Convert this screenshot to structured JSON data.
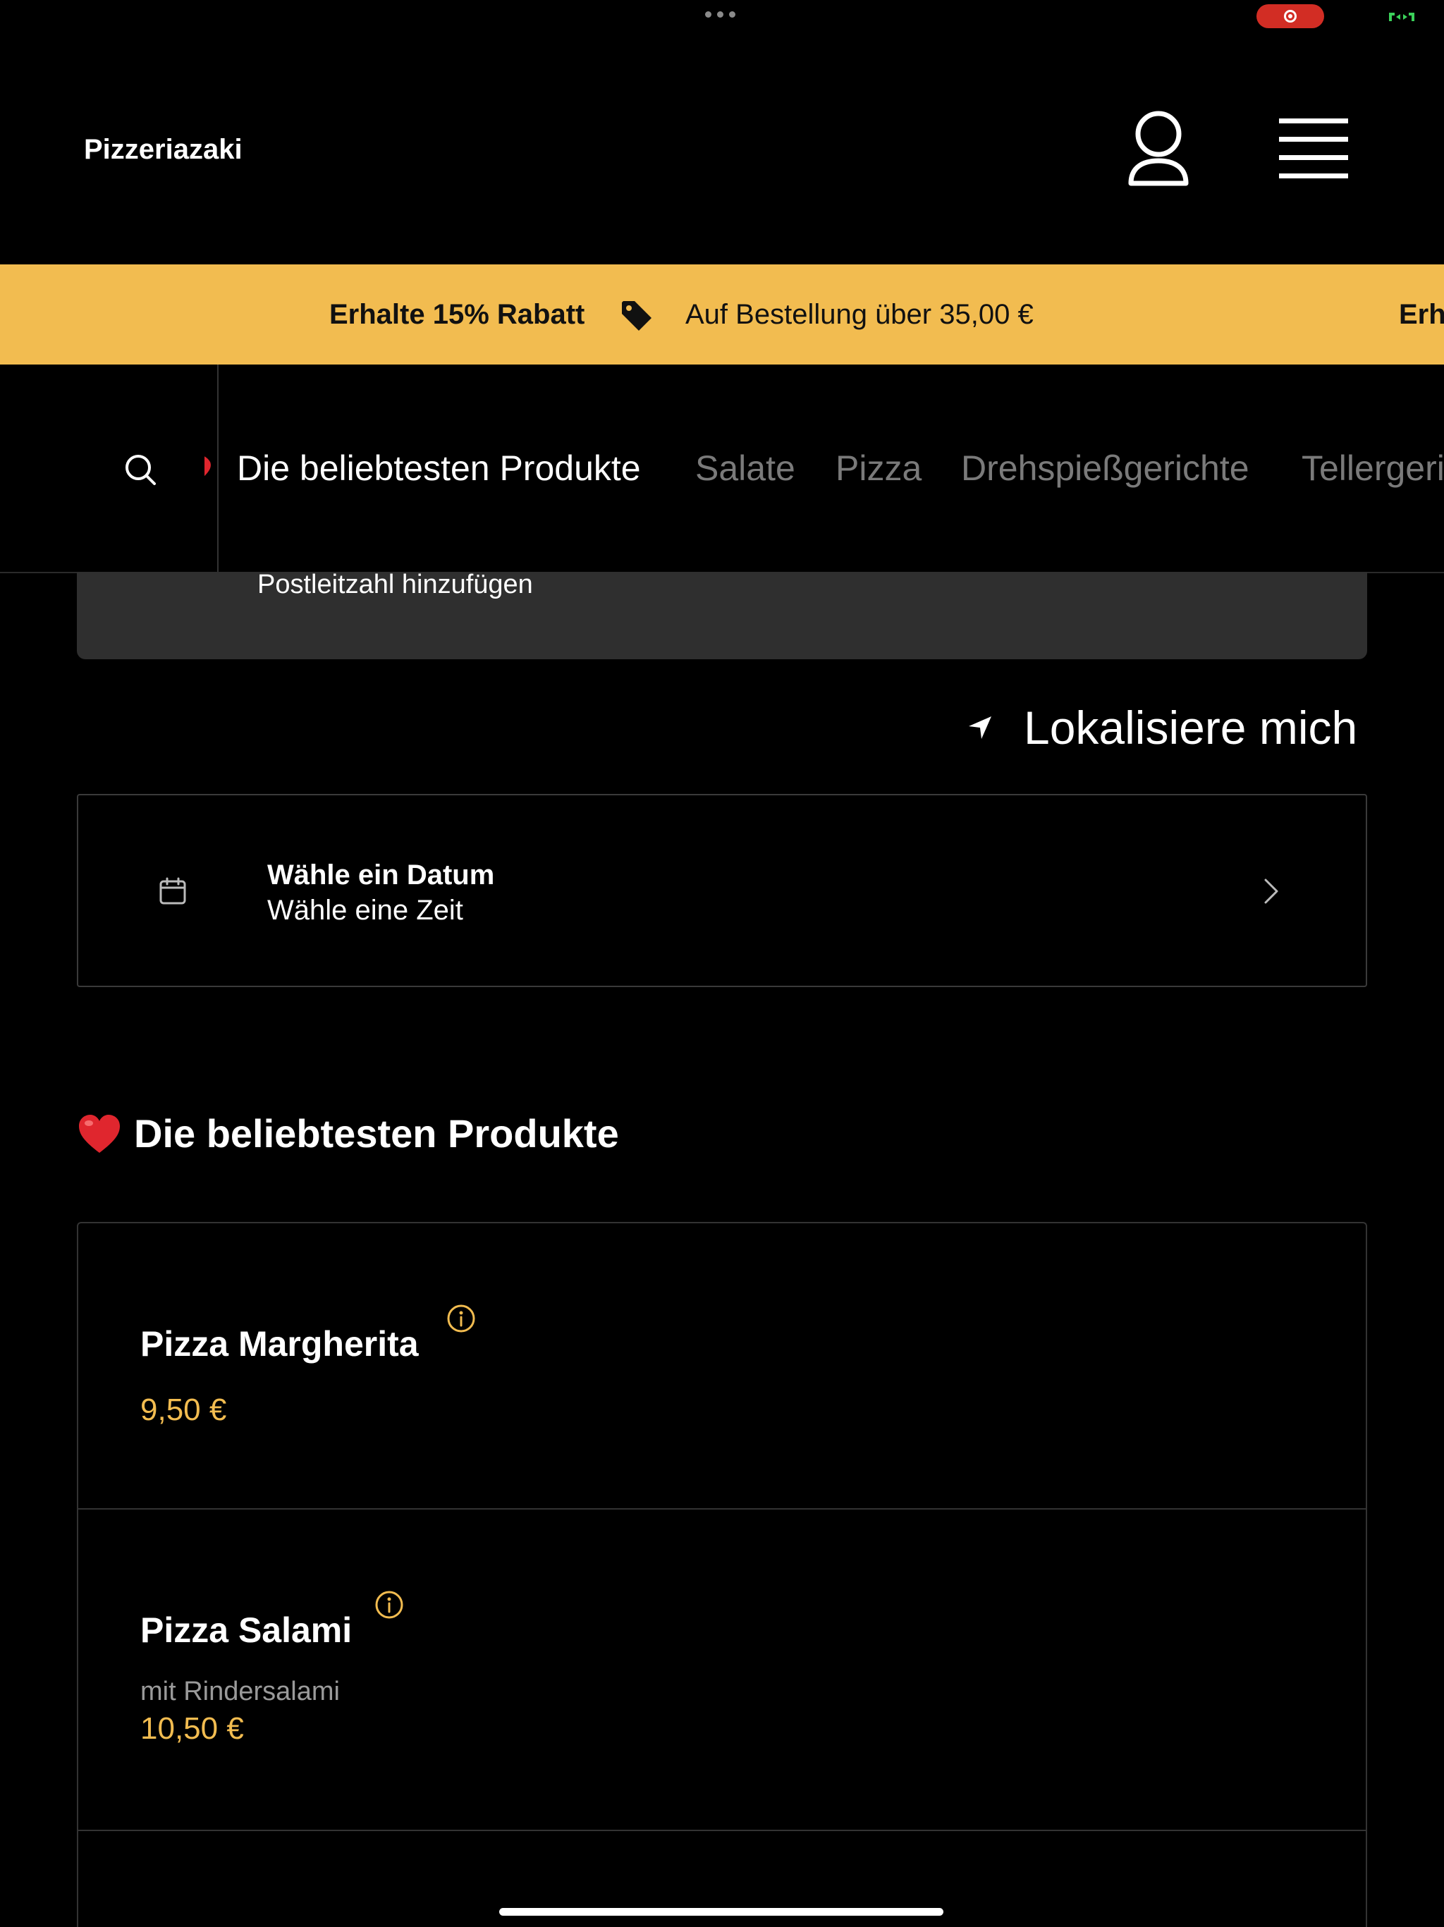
{
  "header": {
    "brand": "Pizzeriazaki"
  },
  "promo": {
    "headline": "Erhalte 15% Rabatt",
    "condition": "Auf Bestellung über 35,00 €",
    "repeat": "Erh"
  },
  "categories": [
    {
      "label": "Die beliebtesten Produkte",
      "active": true
    },
    {
      "label": "Salate",
      "active": false
    },
    {
      "label": "Pizza",
      "active": false
    },
    {
      "label": "Drehspießgerichte",
      "active": false
    },
    {
      "label": "Tellergeri",
      "active": false
    }
  ],
  "postcode": {
    "label": "Postleitzahl hinzufügen"
  },
  "locate": {
    "label": "Lokalisiere mich"
  },
  "schedule": {
    "date_label": "Wähle ein Datum",
    "time_label": "Wähle eine Zeit"
  },
  "section": {
    "title": "Die beliebtesten Produkte"
  },
  "products": [
    {
      "name": "Pizza Margherita",
      "description": "",
      "price": "9,50 €"
    },
    {
      "name": "Pizza Salami",
      "description": "mit Rindersalami",
      "price": "10,50 €"
    }
  ],
  "colors": {
    "accent": "#f2bc50",
    "background": "#000000",
    "card": "#2f2f2f",
    "record": "#d22d24"
  }
}
